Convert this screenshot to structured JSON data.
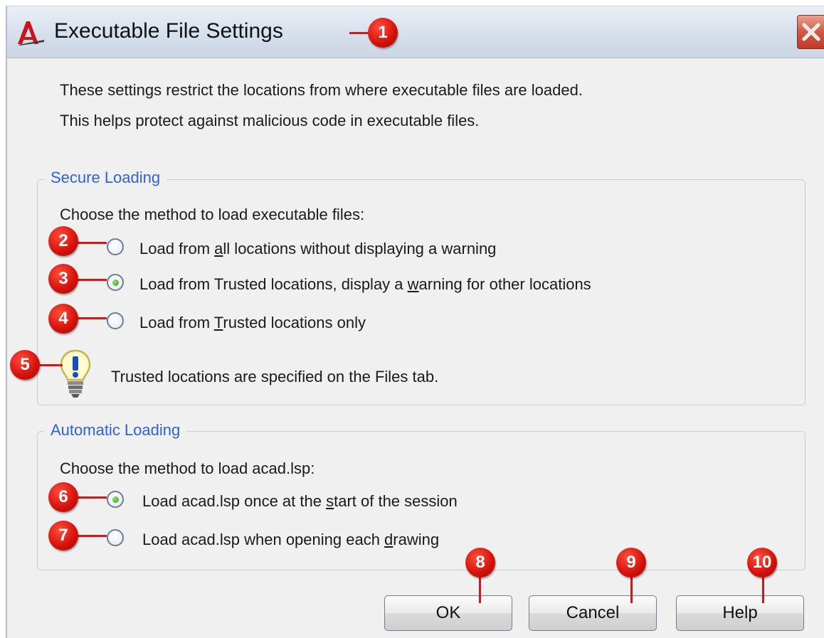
{
  "dialog": {
    "title": "Executable File Settings",
    "icon": "autocad-icon",
    "close_icon": "close-icon"
  },
  "description": "These settings restrict the locations from where executable files are loaded.  This helps protect against malicious code in executable files.",
  "secure_loading": {
    "legend": "Secure Loading",
    "caption": "Choose the method to load executable files:",
    "options": [
      {
        "lead": "Load from ",
        "underline": "a",
        "tail": "ll locations without displaying a warning",
        "selected": false
      },
      {
        "lead": "Load from Trusted locations, display a ",
        "underline": "w",
        "tail": "arning for other locations",
        "selected": true
      },
      {
        "lead": "Load from ",
        "underline": "T",
        "tail": "rusted locations only",
        "selected": false
      }
    ],
    "hint": "Trusted locations are specified on the Files tab.",
    "hint_icon": "lightbulb-warning-icon"
  },
  "automatic_loading": {
    "legend": "Automatic Loading",
    "caption": "Choose the method to load acad.lsp:",
    "options": [
      {
        "lead": "Load acad.lsp once at the ",
        "underline": "s",
        "tail": "tart of the session",
        "selected": true
      },
      {
        "lead": "Load acad.lsp when opening each ",
        "underline": "d",
        "tail": "rawing",
        "selected": false
      }
    ]
  },
  "buttons": {
    "ok": "OK",
    "cancel": "Cancel",
    "help": "Help"
  },
  "callouts": [
    "1",
    "2",
    "3",
    "4",
    "5",
    "6",
    "7",
    "8",
    "9",
    "10"
  ],
  "colors": {
    "callout": "#d2100a",
    "legend": "#2f63d6",
    "radio_selected": "#27a313"
  }
}
